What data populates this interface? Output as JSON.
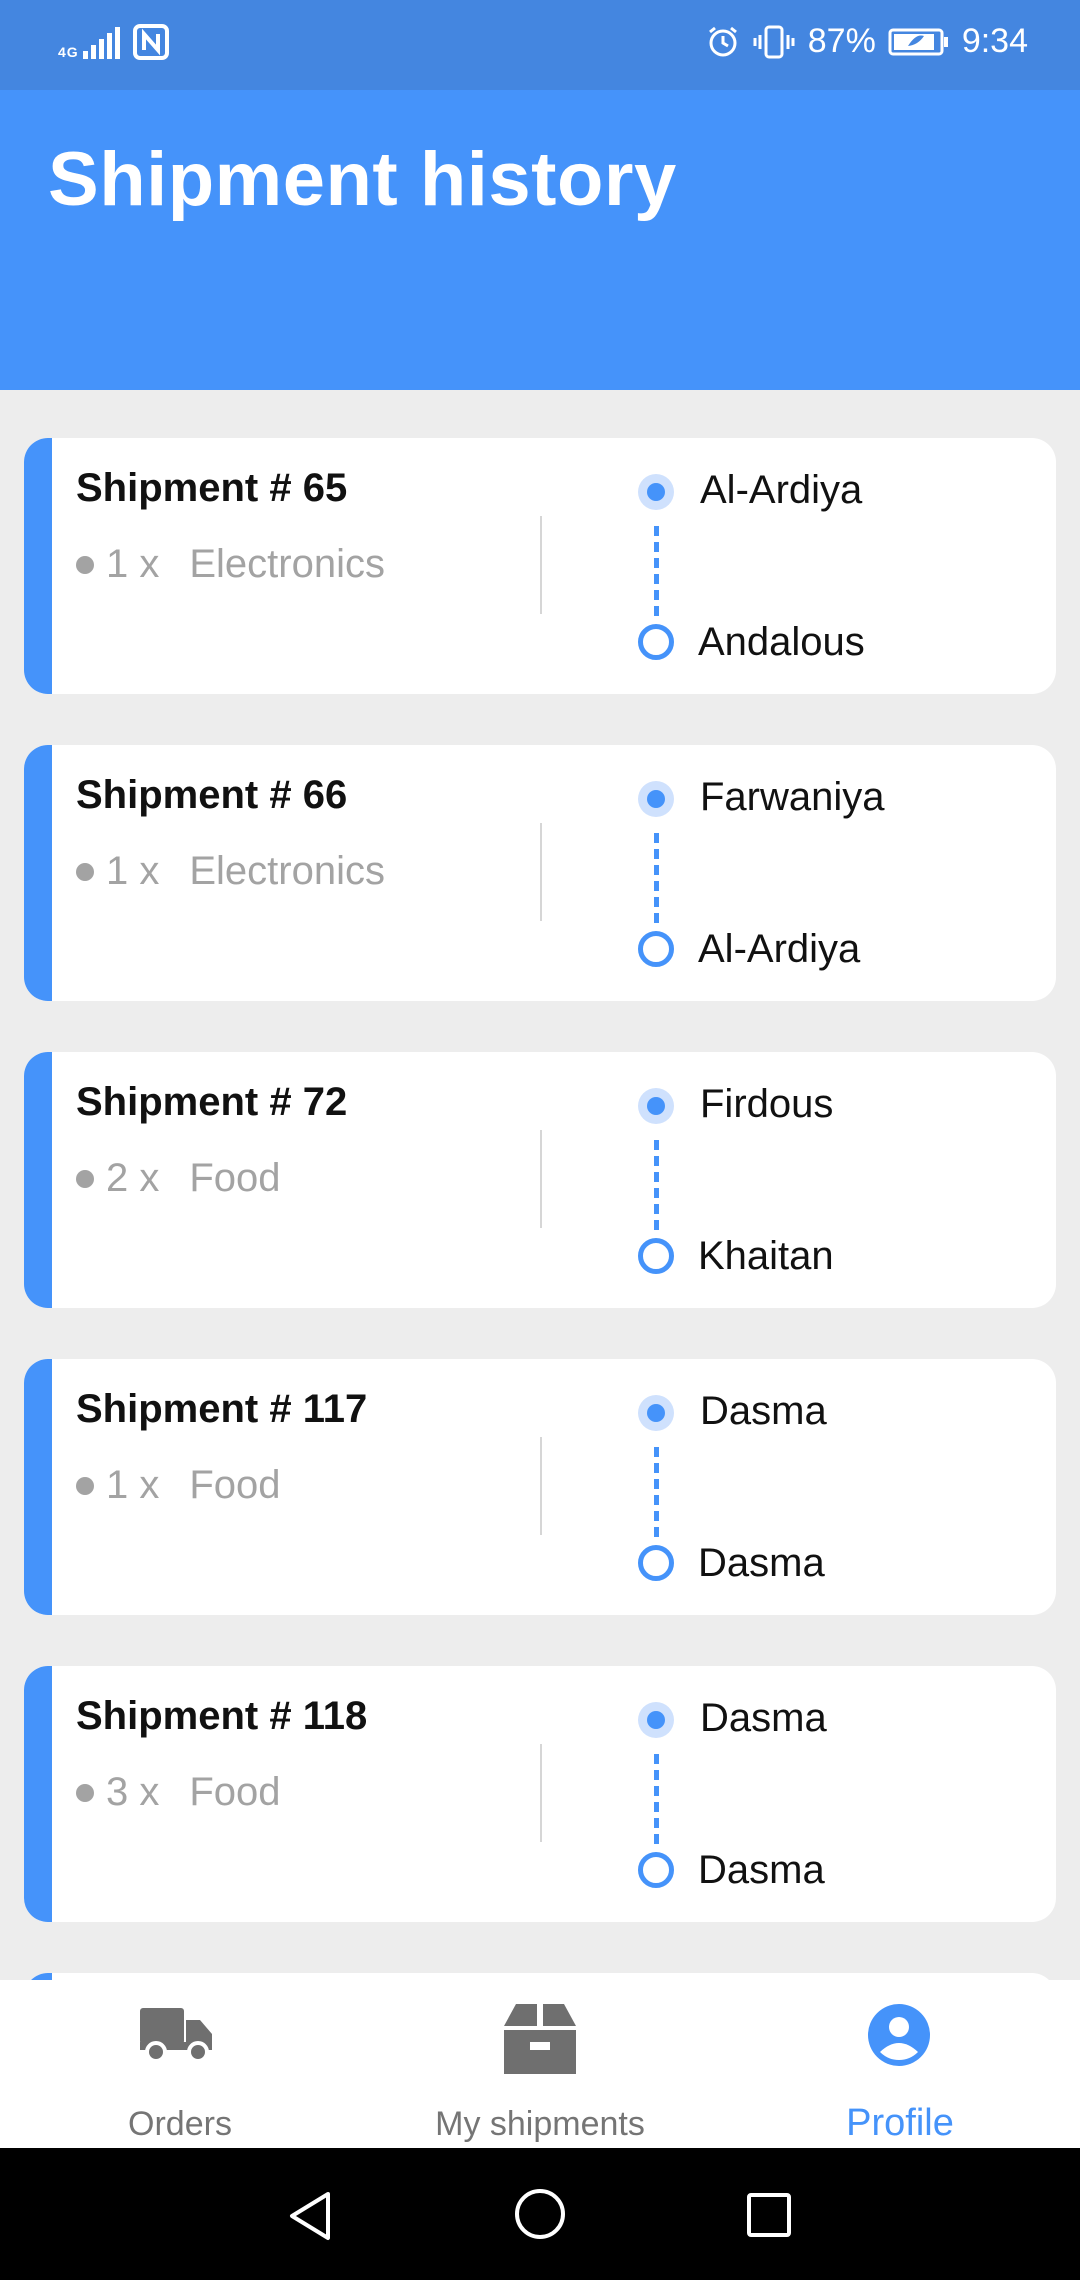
{
  "status_bar": {
    "network": "4G",
    "battery": "87%",
    "time": "9:34"
  },
  "header": {
    "title": "Shipment history"
  },
  "shipments": [
    {
      "title": "Shipment # 65",
      "qty": "1 x",
      "category": "Electronics",
      "from": "Al-Ardiya",
      "to": "Andalous"
    },
    {
      "title": "Shipment # 66",
      "qty": "1 x",
      "category": "Electronics",
      "from": "Farwaniya",
      "to": "Al-Ardiya"
    },
    {
      "title": "Shipment # 72",
      "qty": "2 x",
      "category": "Food",
      "from": "Firdous",
      "to": "Khaitan"
    },
    {
      "title": "Shipment # 117",
      "qty": "1 x",
      "category": "Food",
      "from": "Dasma",
      "to": "Dasma"
    },
    {
      "title": "Shipment # 118",
      "qty": "3 x",
      "category": "Food",
      "from": "Dasma",
      "to": "Dasma"
    }
  ],
  "bottom_nav": {
    "orders_label": "Orders",
    "shipments_label": "My shipments",
    "profile_label": "Profile",
    "active": "profile"
  },
  "colors": {
    "accent": "#4593fa",
    "status_bar": "#4486e0",
    "background": "#ededed"
  }
}
